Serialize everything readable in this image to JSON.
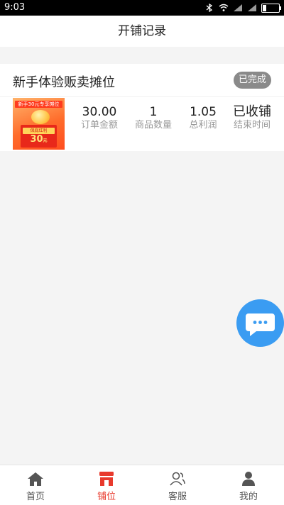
{
  "status": {
    "time": "9:03"
  },
  "header": {
    "title": "开铺记录"
  },
  "record": {
    "title": "新手体验贩卖摊位",
    "badge": "已完成",
    "thumb": {
      "banner": "新手30元专享摊位",
      "label": "保底红利",
      "amount": "30",
      "unit": "元"
    },
    "stats": [
      {
        "value": "30.00",
        "label": "订单金额"
      },
      {
        "value": "1",
        "label": "商品数量"
      },
      {
        "value": "1.05",
        "label": "总利润"
      },
      {
        "value": "已收铺",
        "label": "结束时间"
      }
    ]
  },
  "chat_fab": {
    "icon": "chat-bubble-icon",
    "color": "#3a9cf2"
  },
  "tabs": [
    {
      "label": "首页",
      "icon": "home-icon"
    },
    {
      "label": "铺位",
      "icon": "shop-icon",
      "active": true
    },
    {
      "label": "客服",
      "icon": "customer-service-icon"
    },
    {
      "label": "我的",
      "icon": "profile-icon"
    }
  ],
  "colors": {
    "accent": "#e8392c",
    "badge": "#8a8a8a"
  }
}
